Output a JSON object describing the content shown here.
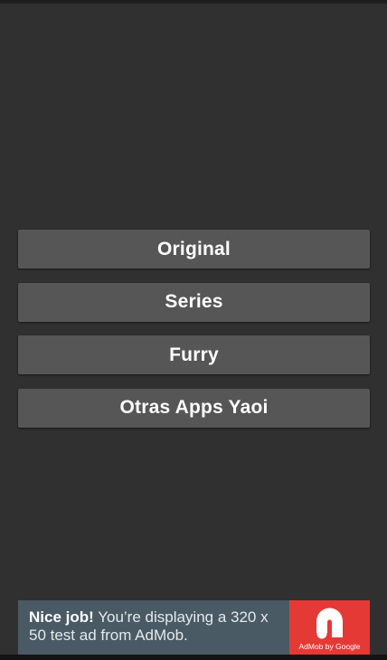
{
  "menu": {
    "buttons": [
      {
        "label": "Original"
      },
      {
        "label": "Series"
      },
      {
        "label": "Furry"
      },
      {
        "label": "Otras Apps Yaoi"
      }
    ]
  },
  "ad": {
    "headline": "Nice job!",
    "body": " You’re displaying a 320 x 50 test ad from AdMob.",
    "logo_caption": "AdMob by Google",
    "logo_icon": "admob-icon",
    "colors": {
      "banner_bg": "#4a5a64",
      "logo_bg": "#e53935"
    }
  },
  "theme": {
    "background": "#303030",
    "button_bg": "#565656",
    "button_text": "#ffffff"
  }
}
